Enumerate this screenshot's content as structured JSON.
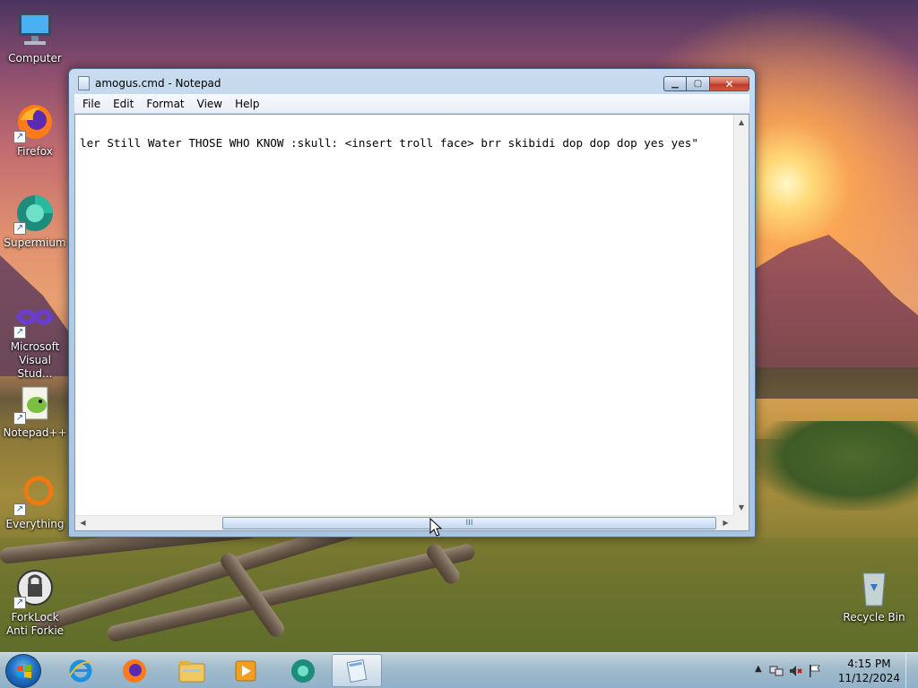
{
  "desktop": {
    "icons": [
      {
        "label": "Computer",
        "icon": "computer-icon"
      },
      {
        "label": "Firefox",
        "icon": "firefox-icon"
      },
      {
        "label": "Supermium",
        "icon": "supermium-icon"
      },
      {
        "label": "Microsoft Visual Stud...",
        "icon": "visual-studio-icon"
      },
      {
        "label": "Notepad++",
        "icon": "notepad-plus-plus-icon"
      },
      {
        "label": "Everything",
        "icon": "everything-search-icon"
      },
      {
        "label": "ForkLock Anti Forkie",
        "icon": "forklock-icon"
      },
      {
        "label": "Recycle Bin",
        "icon": "recycle-bin-icon"
      }
    ]
  },
  "notepad": {
    "title": "amogus.cmd - Notepad",
    "menu": {
      "file": "File",
      "edit": "Edit",
      "format": "Format",
      "view": "View",
      "help": "Help"
    },
    "content": "ler Still Water THOSE WHO KNOW :skull: <insert troll face> brr skibidi dop dop dop yes yes\"",
    "scrollbar_grip": "III"
  },
  "taskbar": {
    "pinned": [
      "internet-explorer-icon",
      "firefox-icon",
      "file-explorer-icon",
      "media-player-icon",
      "supermium-icon",
      "notepad-icon"
    ],
    "active": "notepad-icon",
    "clock_time": "4:15 PM",
    "clock_date": "11/12/2024",
    "tray_icons": [
      "show-hidden-icons-icon",
      "network-icon",
      "volume-muted-icon",
      "action-center-flag-icon"
    ]
  },
  "colors": {
    "window_frame": "#b4cce6",
    "close_button": "#c03828",
    "taskbar": "#aac8e6"
  }
}
